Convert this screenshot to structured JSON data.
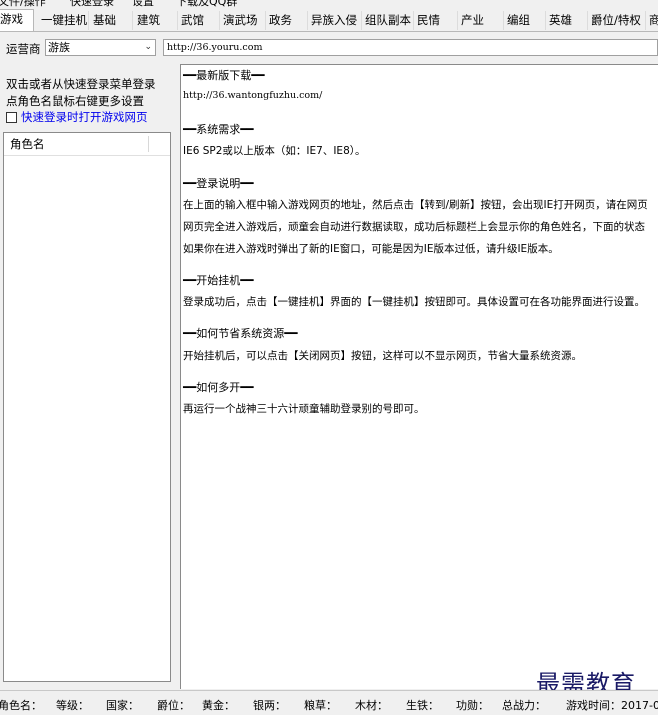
{
  "menubar": {
    "items": [
      "文件/操作",
      "快速登录",
      "设置",
      "下载及QQ群"
    ]
  },
  "tabs": [
    "游戏",
    "一键挂机",
    "基础",
    "建筑",
    "武馆",
    "演武场",
    "政务",
    "异族入侵",
    "组队副本",
    "民情",
    "产业",
    "编组",
    "英雄",
    "爵位/特权",
    "商"
  ],
  "topbar": {
    "operator_label": "运营商",
    "operator_value": "游族",
    "url": "http://36.youru.com"
  },
  "left": {
    "hint_line1": "双击或者从快速登录菜单登录",
    "hint_line2": "点角色名鼠标右键更多设置",
    "checkbox_label": "快速登录时打开游戏网页",
    "list_header": "角色名"
  },
  "content": {
    "s1_title": "━━最新版下载━━",
    "s1_line": "http://36.wantongfuzhu.com/",
    "s2_title": "━━系统需求━━",
    "s2_line": "IE6 SP2或以上版本（如：IE7、IE8）。",
    "s3_title": "━━登录说明━━",
    "s3_line1": "在上面的输入框中输入游戏网页的地址，然后点击【转到/刷新】按钮，会出现IE打开网页，请在网页",
    "s3_line2": "网页完全进入游戏后，顽童会自动进行数据读取，成功后标题栏上会显示你的角色姓名，下面的状态",
    "s3_line3": "如果你在进入游戏时弹出了新的IE窗口，可能是因为IE版本过低，请升级IE版本。",
    "s4_title": "━━开始挂机━━",
    "s4_line": "登录成功后，点击【一键挂机】界面的【一键挂机】按钮即可。具体设置可在各功能界面进行设置。",
    "s5_title": "━━如何节省系统资源━━",
    "s5_line": "开始挂机后，可以点击【关闭网页】按钮，这样可以不显示网页，节省大量系统资源。",
    "s6_title": "━━如何多开━━",
    "s6_line": "再运行一个战神三十六计顽童辅助登录别的号即可。"
  },
  "status": {
    "role": "角色名：",
    "level": "等级：",
    "country": "国家：",
    "title": "爵位：",
    "gold": "黄金：",
    "silver": "银两：",
    "food": "粮草：",
    "wood": "木材：",
    "iron": "生铁：",
    "merit": "功勋：",
    "power": "总战力：",
    "game_time": "游戏时间：2017-0"
  },
  "watermark": "最需教育"
}
